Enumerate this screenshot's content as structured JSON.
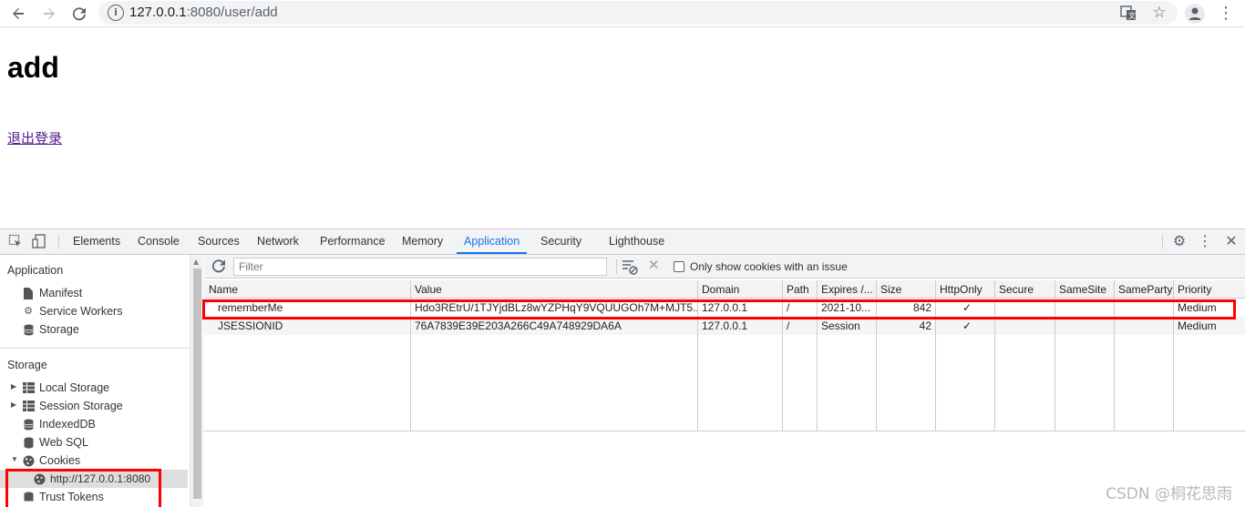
{
  "browser": {
    "url_host": "127.0.0.1",
    "url_path": ":8080/user/add"
  },
  "page": {
    "heading": "add",
    "logout_link": "退出登录"
  },
  "devtools": {
    "tabs": [
      "Elements",
      "Console",
      "Sources",
      "Network",
      "Performance",
      "Memory",
      "Application",
      "Security",
      "Lighthouse"
    ],
    "active_tab": "Application",
    "sidebar": {
      "application_title": "Application",
      "application_items": [
        "Manifest",
        "Service Workers",
        "Storage"
      ],
      "storage_title": "Storage",
      "storage_items": [
        "Local Storage",
        "Session Storage",
        "IndexedDB",
        "Web SQL",
        "Cookies",
        "Trust Tokens"
      ],
      "cookie_origin": "http://127.0.0.1:8080"
    },
    "filter": {
      "placeholder": "Filter",
      "only_issues_label": "Only show cookies with an issue"
    },
    "table": {
      "columns": [
        "Name",
        "Value",
        "Domain",
        "Path",
        "Expires /...",
        "Size",
        "HttpOnly",
        "Secure",
        "SameSite",
        "SameParty",
        "Priority"
      ],
      "rows": [
        {
          "name": "rememberMe",
          "value": "Hdo3REtrU/1TJYjdBLz8wYZPHqY9VQUUGOh7M+MJT5...",
          "domain": "127.0.0.1",
          "path": "/",
          "expires": "2021-10...",
          "size": "842",
          "httponly": "✓",
          "secure": "",
          "samesite": "",
          "sameparty": "",
          "priority": "Medium"
        },
        {
          "name": "JSESSIONID",
          "value": "76A7839E39E203A266C49A748929DA6A",
          "domain": "127.0.0.1",
          "path": "/",
          "expires": "Session",
          "size": "42",
          "httponly": "✓",
          "secure": "",
          "samesite": "",
          "sameparty": "",
          "priority": "Medium"
        }
      ]
    }
  },
  "watermark": "CSDN @桐花思雨"
}
